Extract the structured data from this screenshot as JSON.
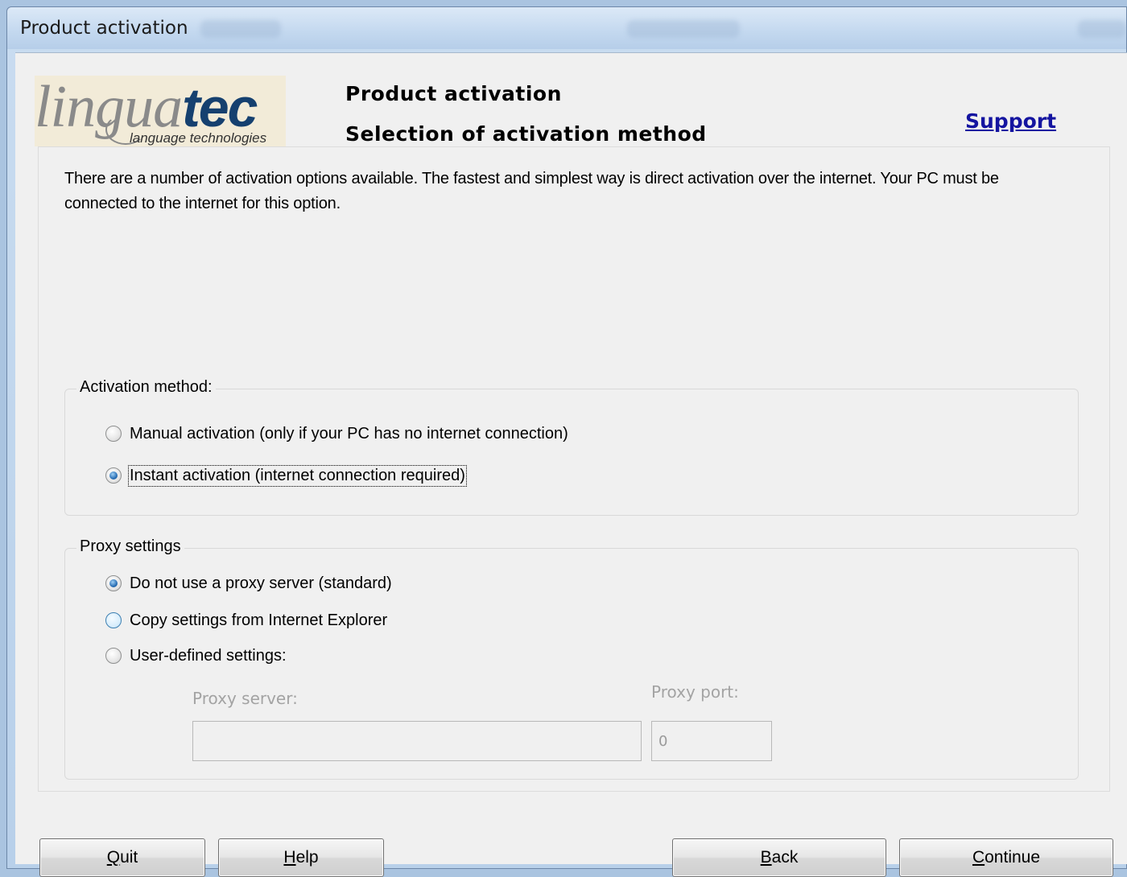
{
  "window": {
    "title": "Product activation"
  },
  "header": {
    "logo": {
      "brand_light": "lingua",
      "brand_bold": "tec",
      "tagline": "language technologies"
    },
    "title": "Product activation",
    "subtitle": "Selection of activation method",
    "support_link": "Support"
  },
  "intro_text": "There are a number of activation options available. The fastest and simplest way is direct activation over the internet. Your PC must be connected to the internet for this option.",
  "activation_method": {
    "legend": "Activation method:",
    "options": [
      {
        "label": "Manual activation (only if your PC has no internet connection)",
        "selected": false
      },
      {
        "label": "Instant activation (internet connection required)",
        "selected": true
      }
    ]
  },
  "proxy_settings": {
    "legend": "Proxy settings",
    "options": [
      {
        "label": "Do not use a proxy server (standard)",
        "selected": true
      },
      {
        "label": "Copy settings from Internet Explorer",
        "selected": false
      },
      {
        "label": "User-defined settings:",
        "selected": false
      }
    ],
    "proxy_server": {
      "label": "Proxy server:",
      "value": ""
    },
    "proxy_port": {
      "label": "Proxy port:",
      "value": "0"
    }
  },
  "buttons": {
    "quit": {
      "mnemonic": "Q",
      "rest": "uit"
    },
    "help": {
      "mnemonic": "H",
      "rest": "elp"
    },
    "back": {
      "mnemonic": "B",
      "rest": "ack"
    },
    "continue": {
      "mnemonic": "C",
      "rest": "ontinue"
    }
  },
  "colors": {
    "support_link": "#1414a0",
    "logo_dark_blue": "#15406f",
    "dialog_background": "#f0f0f0"
  }
}
